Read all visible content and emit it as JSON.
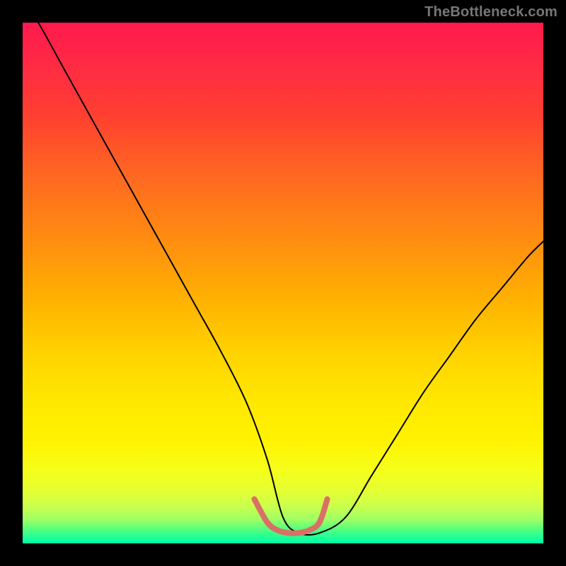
{
  "watermark": "TheBottleneck.com",
  "chart_data": {
    "type": "line",
    "title": "",
    "xlabel": "",
    "ylabel": "",
    "xlim": [
      0,
      100
    ],
    "ylim": [
      0,
      100
    ],
    "grid": false,
    "legend": false,
    "background_gradient": {
      "direction": "vertical",
      "stops": [
        {
          "pos": 0,
          "color": "#ff1a4d"
        },
        {
          "pos": 0.3,
          "color": "#ff6a20"
        },
        {
          "pos": 0.6,
          "color": "#ffd400"
        },
        {
          "pos": 0.85,
          "color": "#f5ff1a"
        },
        {
          "pos": 0.97,
          "color": "#4dff80"
        },
        {
          "pos": 1.0,
          "color": "#00ffaa"
        }
      ]
    },
    "series": [
      {
        "name": "bottleneck-curve-black",
        "color": "#000000",
        "stroke_width": 2,
        "x": [
          0,
          3,
          8,
          13,
          18,
          23,
          28,
          33,
          38,
          43,
          47,
          50,
          53,
          57,
          62,
          67,
          72,
          77,
          82,
          87,
          92,
          97,
          100
        ],
        "y": [
          104,
          100,
          91,
          82,
          73,
          64,
          55,
          46,
          37,
          27,
          16,
          5,
          2,
          2,
          5,
          13,
          21,
          29,
          36,
          43,
          49,
          55,
          58
        ]
      },
      {
        "name": "optimal-band-salmon",
        "color": "#d97066",
        "stroke_width": 8,
        "x": [
          44.5,
          47,
          49,
          51,
          53,
          55,
          57,
          58.5
        ],
        "y": [
          8.5,
          4,
          2.5,
          2,
          2,
          2.5,
          4,
          8.5
        ]
      }
    ],
    "annotations": []
  }
}
